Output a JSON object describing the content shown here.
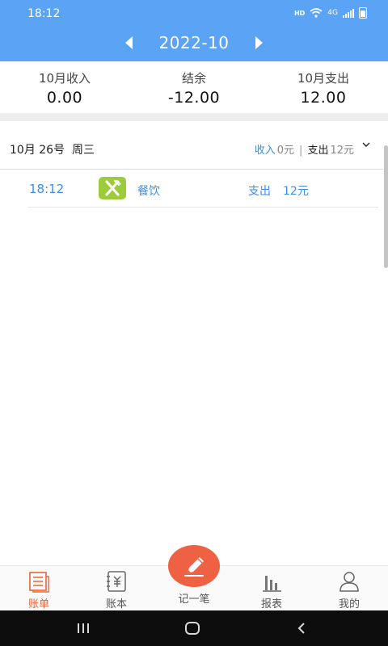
{
  "status_bar": {
    "time": "18:12",
    "hd": "HD",
    "network": "4G"
  },
  "header": {
    "month": "2022-10"
  },
  "summary": [
    {
      "label": "10月收入",
      "value": "0.00"
    },
    {
      "label": "结余",
      "value": "-12.00"
    },
    {
      "label": "10月支出",
      "value": "12.00"
    }
  ],
  "day_group": {
    "date": "10月 26号",
    "weekday": "周三",
    "income_label": "收入",
    "income_value": "0元",
    "expense_label": "支出",
    "expense_value": "12元"
  },
  "entries": [
    {
      "time": "18:12",
      "category": "餐饮",
      "category_icon": "fork-knife-icon",
      "type": "支出",
      "amount": "12元"
    }
  ],
  "bottom_nav": {
    "items": [
      {
        "label": "账单",
        "icon": "bill-list-icon",
        "active": true
      },
      {
        "label": "账本",
        "icon": "ledger-icon",
        "active": false
      },
      {
        "label": "记一笔",
        "icon": "pencil-icon",
        "active": false
      },
      {
        "label": "报表",
        "icon": "bar-chart-icon",
        "active": false
      },
      {
        "label": "我的",
        "icon": "profile-icon",
        "active": false
      }
    ]
  },
  "colors": {
    "header_bg": "#5aa3f5",
    "accent_blue": "#3a8ee6",
    "accent_orange": "#e8653a",
    "fab_bg": "#ee6142",
    "category_green": "#9ccc3c"
  }
}
